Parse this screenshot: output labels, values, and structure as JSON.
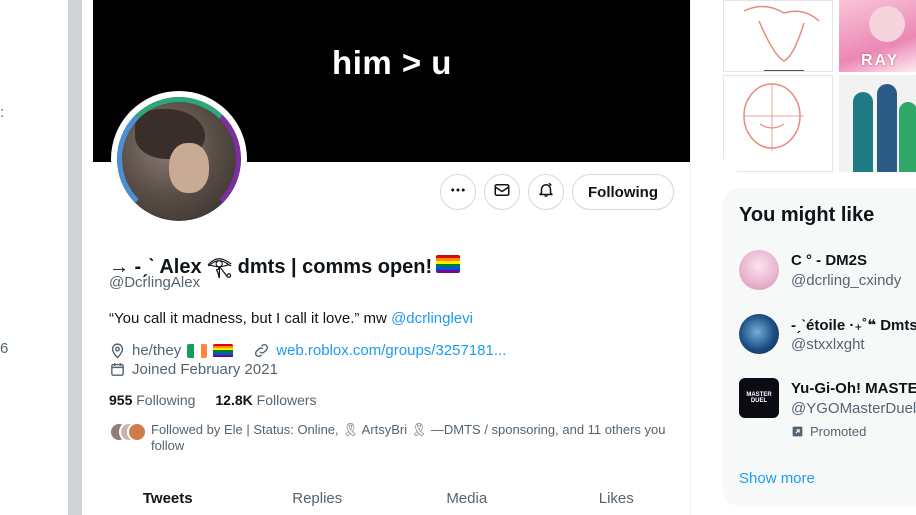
{
  "left_fragments": [
    ":",
    "6"
  ],
  "banner": {
    "text": "him > u"
  },
  "profile": {
    "display_name": "→ -ˏˋ Alex 𓂀 dmts | comms open!",
    "handle": "@DcrlingAlex",
    "bio_text": "“You call it madness, but I call it love.” mw ",
    "bio_mention": "@dcrlinglevi",
    "pronouns": "he/they",
    "website": "web.roblox.com/groups/3257181...",
    "joined": "Joined February 2021",
    "following_count": "955",
    "following_label": "Following",
    "followers_count": "12.8K",
    "followers_label": "Followers",
    "followed_by": "Followed by Ele | Status: Online, 🎗 ArtsyBri 🎗 —DMTS / sponsoring, and 11 others you follow",
    "rainbow_colors": [
      "#e40303",
      "#ff8c00",
      "#ffed00",
      "#008026",
      "#004dff",
      "#750787"
    ]
  },
  "actions": {
    "more_icon": "more-icon",
    "message_icon": "mail-icon",
    "notify_icon": "bell-icon",
    "following_button": "Following"
  },
  "tabs": [
    {
      "label": "Tweets",
      "active": true
    },
    {
      "label": "Replies",
      "active": false
    },
    {
      "label": "Media",
      "active": false
    },
    {
      "label": "Likes",
      "active": false
    }
  ],
  "sidebar": {
    "media_thumb_text": "RAY",
    "you_might_like": {
      "title": "You might like",
      "items": [
        {
          "name": "C ° - DM2S",
          "handle": "@dcrling_cxindy",
          "promoted": ""
        },
        {
          "name": "-ˏˋétoile ·₊˚❝ Dmts ·",
          "handle": "@stxxlxght",
          "promoted": ""
        },
        {
          "name": "Yu-Gi-Oh! MASTER",
          "handle": "@YGOMasterDuel",
          "promoted": "Promoted",
          "avatar_text": "MASTER DUEL"
        }
      ],
      "show_more": "Show more"
    }
  },
  "colors": {
    "accent": "#1d9bf0",
    "text": "#0f1419",
    "muted": "#536471"
  }
}
